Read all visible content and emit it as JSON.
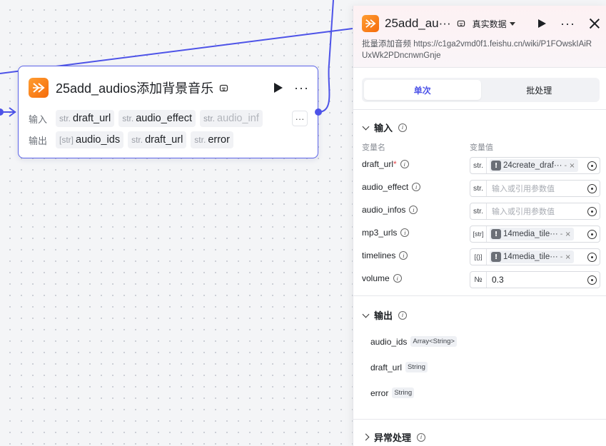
{
  "node": {
    "title": "25add_audios添加背景音乐",
    "input_label": "输入",
    "output_label": "输出",
    "inputs": [
      {
        "type": "str.",
        "name": "draft_url"
      },
      {
        "type": "str.",
        "name": "audio_effect"
      },
      {
        "type": "str.",
        "name": "audio_inf"
      }
    ],
    "more_label": "···",
    "outputs": [
      {
        "type": "[str]",
        "name": "audio_ids"
      },
      {
        "type": "str.",
        "name": "draft_url"
      },
      {
        "type": "str.",
        "name": "error"
      }
    ]
  },
  "panel": {
    "title": "25add_au···",
    "data_select": "真实数据",
    "description": "批量添加音频 https://c1ga2vmd0f1.feishu.cn/wiki/P1FOwskIAiRUxWk2PDncnwnGnje",
    "tabs": [
      {
        "label": "单次",
        "active": true
      },
      {
        "label": "批处理",
        "active": false
      }
    ],
    "input_section": {
      "title": "输入",
      "col_name": "变量名",
      "col_value": "变量值",
      "params": [
        {
          "name": "draft_url",
          "required": true,
          "type": "str.",
          "kind": "ref",
          "ref": "24create_draf···",
          "ref_extra": "-  ×"
        },
        {
          "name": "audio_effect",
          "required": false,
          "type": "str.",
          "kind": "placeholder",
          "placeholder": "输入或引用参数值"
        },
        {
          "name": "audio_infos",
          "required": false,
          "type": "str.",
          "kind": "placeholder",
          "placeholder": "输入或引用参数值"
        },
        {
          "name": "mp3_urls",
          "required": false,
          "type": "[str]",
          "kind": "ref",
          "ref": "14media_tile···",
          "ref_extra": "-  ×"
        },
        {
          "name": "timelines",
          "required": false,
          "type": "[{}]",
          "kind": "ref",
          "ref": "14media_tile···",
          "ref_extra": "-  ×"
        },
        {
          "name": "volume",
          "required": false,
          "type": "№",
          "kind": "value",
          "value": "0.3"
        }
      ]
    },
    "output_section": {
      "title": "输出",
      "items": [
        {
          "name": "audio_ids",
          "type": "Array<String>"
        },
        {
          "name": "draft_url",
          "type": "String"
        },
        {
          "name": "error",
          "type": "String"
        }
      ]
    },
    "error_section": {
      "title": "异常处理"
    }
  },
  "colors": {
    "accent": "#4d53e8",
    "brand_orange": "#f56b0a"
  }
}
